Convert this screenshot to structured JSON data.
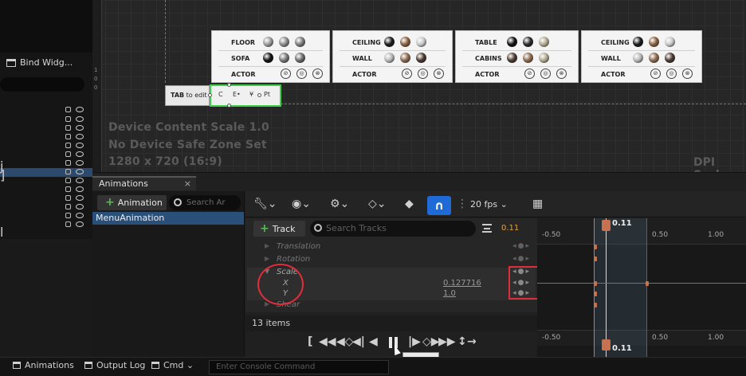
{
  "hierarchy": {
    "bind_widgets_label": "Bind Widg...",
    "side_labels": [
      "j",
      "]",
      "l"
    ]
  },
  "canvas": {
    "ruler_marks": [
      "1",
      "0",
      "0"
    ],
    "cards": [
      {
        "rows": [
          "FLOOR",
          "SOFA",
          "ACTOR"
        ]
      },
      {
        "rows": [
          "CEILING",
          "WALL",
          "ACTOR"
        ]
      },
      {
        "rows": [
          "TABLE",
          "CABINS",
          "ACTOR"
        ]
      },
      {
        "rows": [
          "CEILING",
          "WALL",
          "ACTOR"
        ]
      }
    ],
    "tab_label": "TAB",
    "tab_hint": "to edit",
    "selected_widget_glyphs": [
      "C",
      "E•",
      "¥",
      "Pt"
    ],
    "overlay_lines": [
      "Device Content Scale 1.0",
      "No Device Safe Zone Set",
      "1280 x 720 (16:9)"
    ],
    "dpi_label": "DPI Scale"
  },
  "animations": {
    "tab_title": "Animations",
    "close_glyph": "×",
    "add_button": "Animation",
    "search_placeholder": "Search Ar",
    "items": [
      "MenuAnimation"
    ]
  },
  "sequencer": {
    "fps": "20 fps",
    "add_track": "Track",
    "search_placeholder": "Search Tracks",
    "time_value": "0.11",
    "tracks": [
      {
        "label": "Translation",
        "expanded": false
      },
      {
        "label": "Rotation",
        "expanded": false
      },
      {
        "label": "Scale",
        "expanded": true
      },
      {
        "label": "X",
        "value": "0.127716"
      },
      {
        "label": "Y",
        "value": "1.0"
      },
      {
        "label": "Shear",
        "expanded": false
      }
    ],
    "items_count": "13 items",
    "tooltip": "Pause"
  },
  "timeline": {
    "ticks_top": [
      "-0.50",
      "0.50",
      "1.00"
    ],
    "ticks_bottom": [
      "-0.50",
      "0.50",
      "1.00"
    ],
    "playhead_top": "0.11",
    "playhead_bottom": "0.11",
    "colors": {
      "selection_start": "#3ec04a",
      "selection_end": "#cc3333",
      "playhead": "#c87151"
    }
  },
  "status_bar": {
    "tabs": [
      "Animations",
      "Output Log"
    ],
    "cmd": "Cmd",
    "console_placeholder": "Enter Console Command"
  },
  "annotations": {
    "highlight_color": "#e02d3b"
  }
}
